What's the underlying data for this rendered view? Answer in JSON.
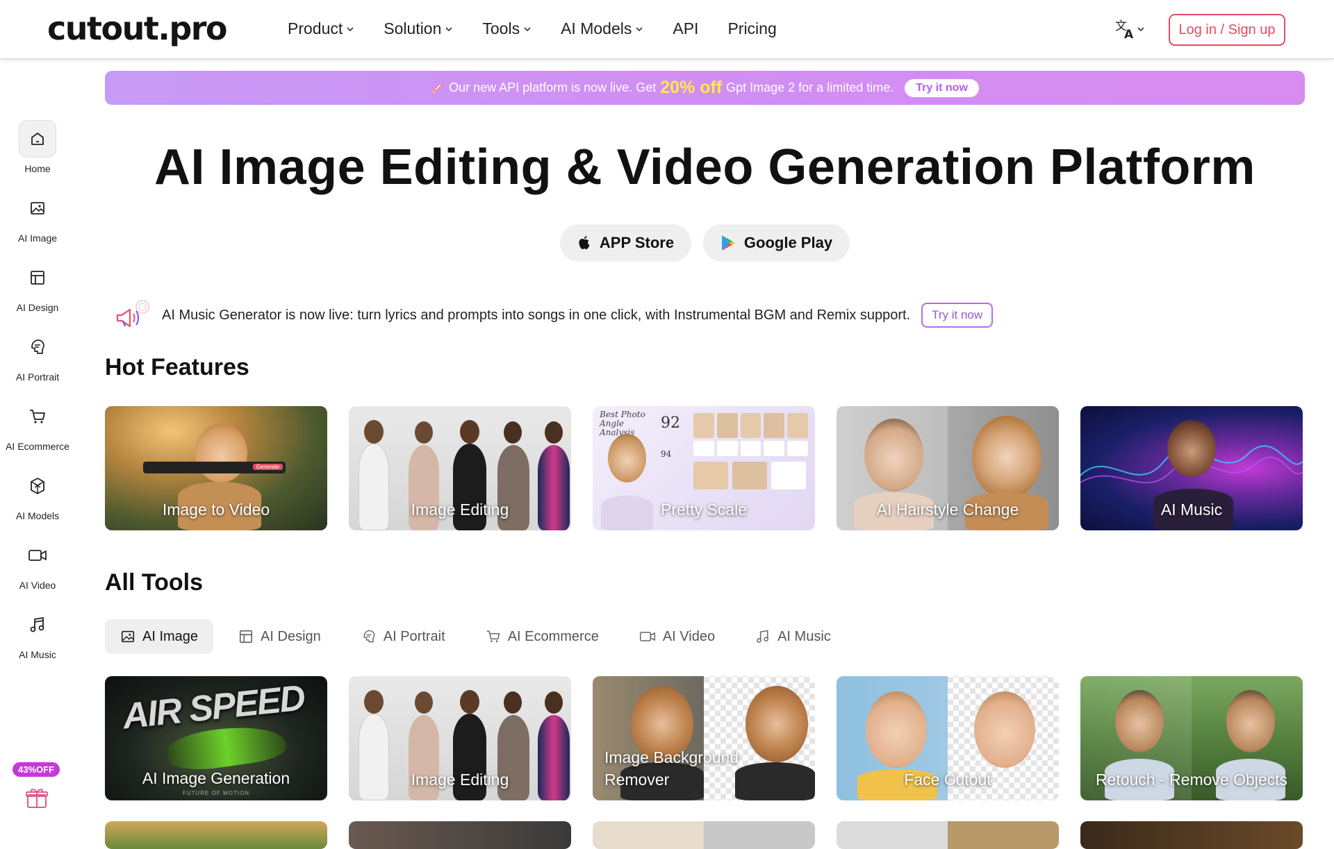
{
  "header": {
    "logo": "cutout.pro",
    "nav": [
      {
        "label": "Product",
        "dropdown": true
      },
      {
        "label": "Solution",
        "dropdown": true
      },
      {
        "label": "Tools",
        "dropdown": true
      },
      {
        "label": "AI Models",
        "dropdown": true
      },
      {
        "label": "API",
        "dropdown": false
      },
      {
        "label": "Pricing",
        "dropdown": false
      }
    ],
    "language_icon": "translate-icon",
    "login_label": "Log in / Sign up"
  },
  "promo": {
    "before": "Our new API platform is now live. Get",
    "highlight": "20% off",
    "after": "Gpt Image 2 for a limited time.",
    "cta": "Try it now"
  },
  "sidebar": {
    "items": [
      {
        "label": "Home",
        "icon": "home-icon",
        "active": true
      },
      {
        "label": "AI Image",
        "icon": "image-icon"
      },
      {
        "label": "AI Design",
        "icon": "layout-icon"
      },
      {
        "label": "AI Portrait",
        "icon": "portrait-icon"
      },
      {
        "label": "AI Ecommerce",
        "icon": "cart-icon"
      },
      {
        "label": "AI Models",
        "icon": "cube-icon"
      },
      {
        "label": "AI Video",
        "icon": "video-icon"
      },
      {
        "label": "AI Music",
        "icon": "music-icon"
      }
    ],
    "discount_badge": "43%OFF",
    "gift_icon": "gift-icon"
  },
  "hero": {
    "title": "AI Image Editing & Video Generation Platform",
    "app_store": "APP Store",
    "google_play": "Google Play"
  },
  "announcement": {
    "text": "AI Music Generator is now live: turn lyrics and prompts into songs in one click, with Instrumental BGM and Remix support.",
    "cta": "Try it now"
  },
  "hot_features": {
    "title": "Hot Features",
    "cards": [
      {
        "label": "Image to Video",
        "overlay_button": "Generate"
      },
      {
        "label": "Image Editing"
      },
      {
        "label": "Pretty Scale",
        "overlay_title": "Best Photo Angle Analysis",
        "overlay_score": "92",
        "overlay_score_2": "94"
      },
      {
        "label": "AI Hairstyle Change"
      },
      {
        "label": "AI Music"
      }
    ]
  },
  "all_tools": {
    "title": "All Tools",
    "tabs": [
      {
        "label": "AI Image",
        "icon": "image-icon",
        "active": true
      },
      {
        "label": "AI Design",
        "icon": "layout-icon"
      },
      {
        "label": "AI Portrait",
        "icon": "portrait-icon"
      },
      {
        "label": "AI Ecommerce",
        "icon": "cart-icon"
      },
      {
        "label": "AI Video",
        "icon": "video-icon"
      },
      {
        "label": "AI Music",
        "icon": "music-icon"
      }
    ],
    "cards": [
      {
        "label": "AI Image Generation",
        "overlay_text": "AIR SPEED",
        "overlay_sub": "FUTURE OF MOTION"
      },
      {
        "label": "Image Editing"
      },
      {
        "label_line1": "Image Background",
        "label_line2": "Remover"
      },
      {
        "label": "Face Cutout"
      },
      {
        "label": "Retouch - Remove Objects"
      }
    ]
  },
  "colors": {
    "accent": "#e24c61",
    "promo_gradient_start": "#c79af5",
    "promo_highlight": "#ffe84a",
    "announce_border": "#b06de8",
    "discount_badge": "#c43ad8"
  }
}
